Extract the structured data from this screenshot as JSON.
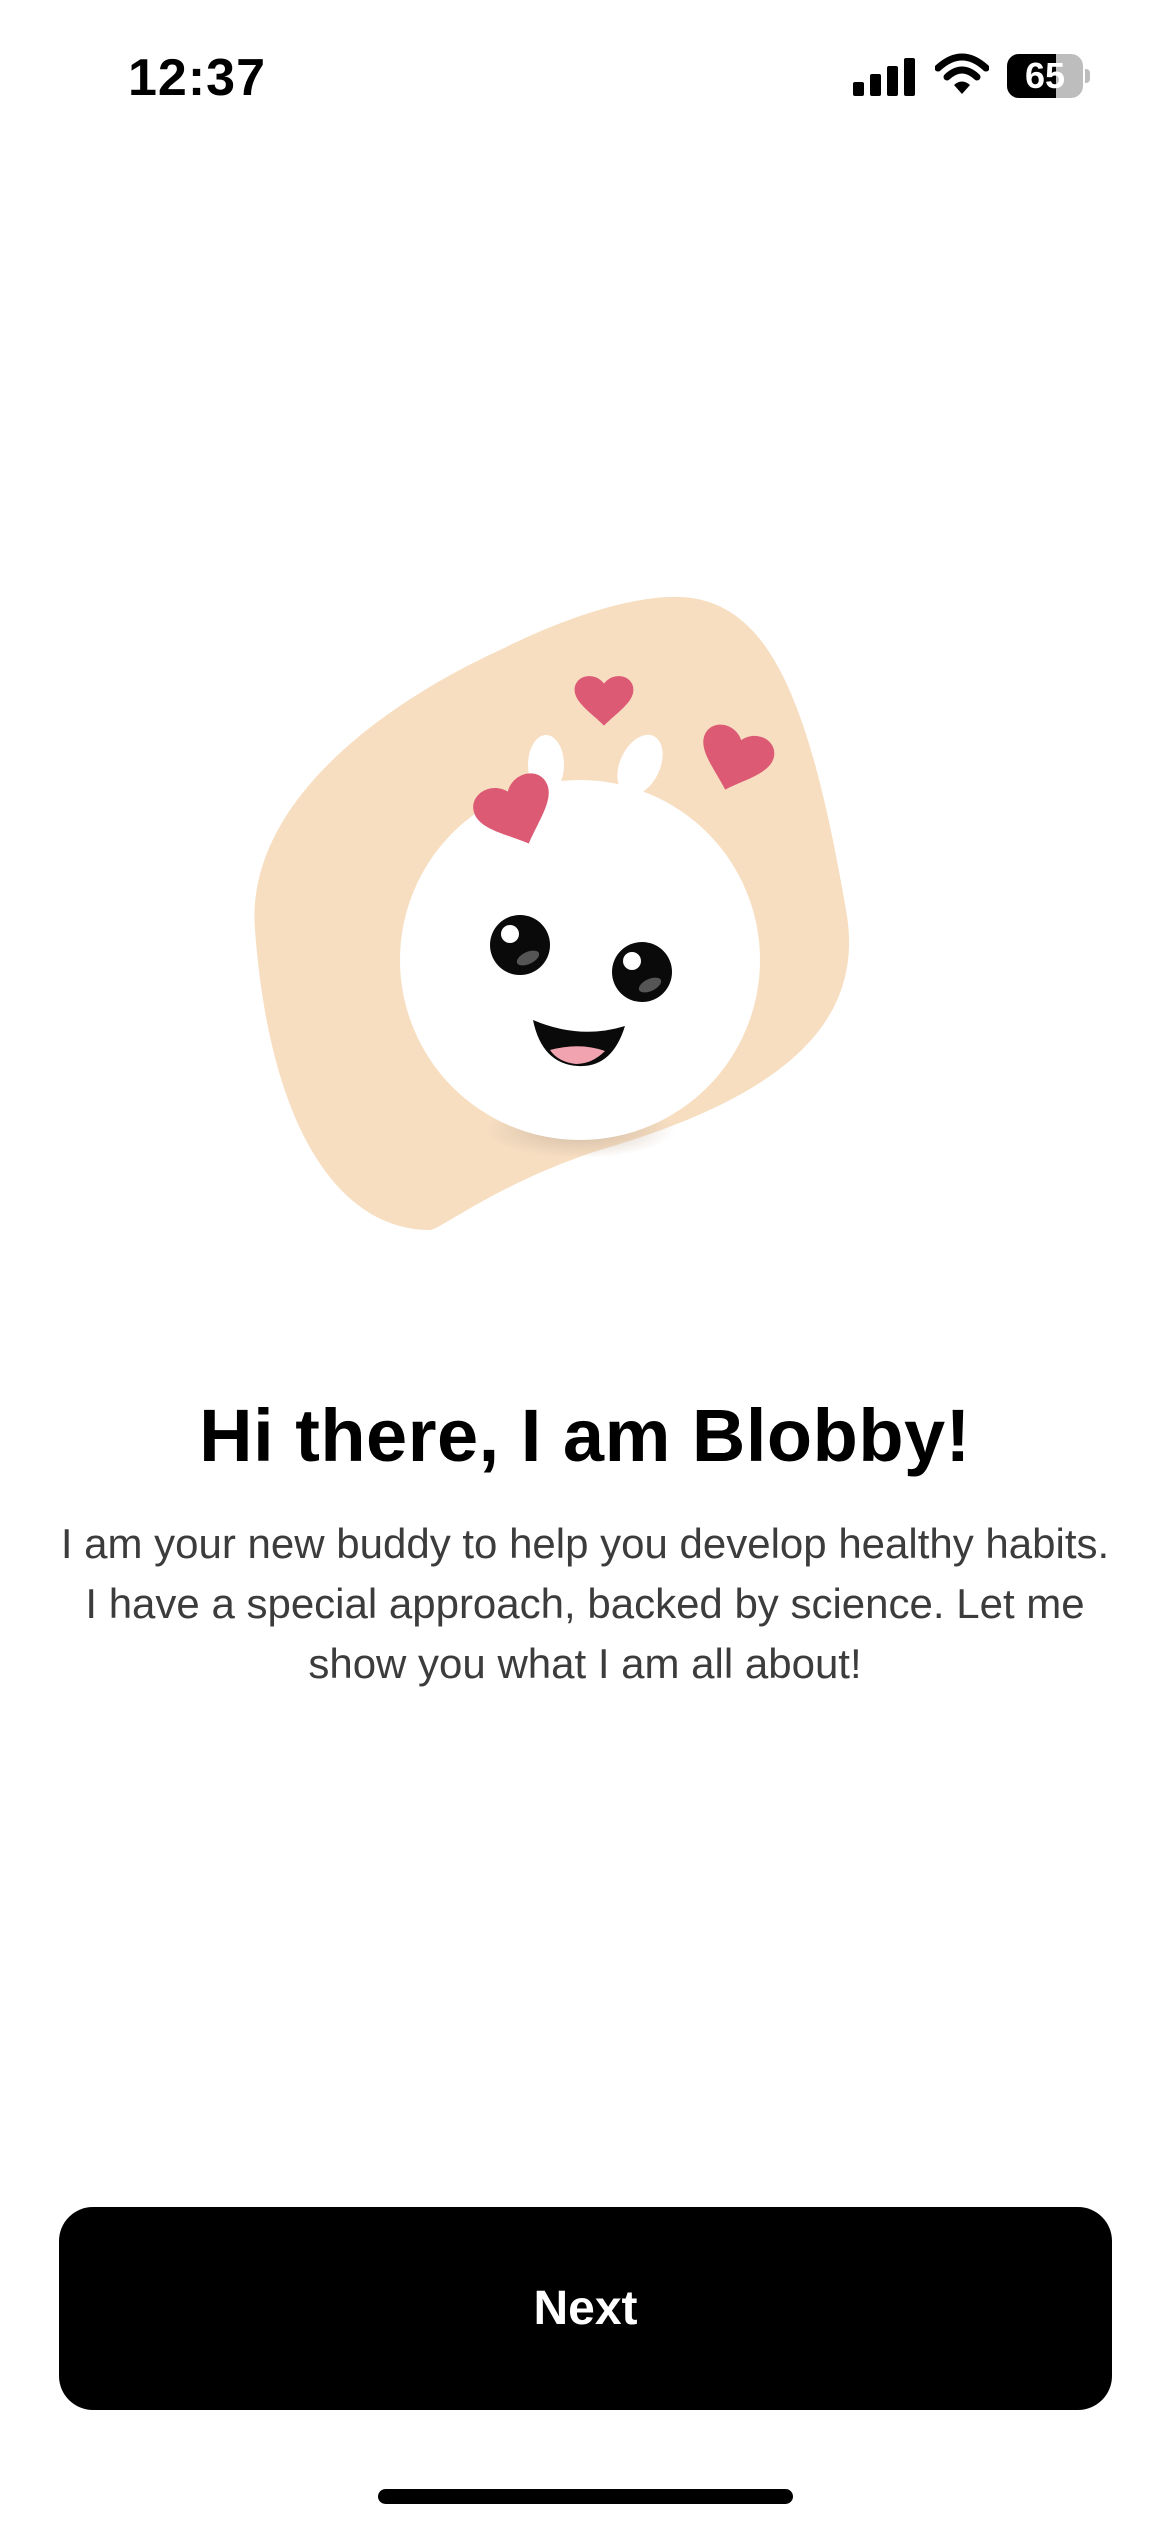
{
  "status_bar": {
    "time": "12:37",
    "battery_level": "65",
    "battery_fraction": 0.65
  },
  "onboarding": {
    "title": "Hi there, I am Blobby!",
    "description": "I am your new buddy to help you develop healthy habits. I have a special approach, backed by science. Let me show you what I am all about!",
    "next_label": "Next"
  },
  "colors": {
    "background": "#FFFFFF",
    "blob_background": "#F7DEC1",
    "heart": "#DC5A74",
    "button": "#000000",
    "button_text": "#FFFFFF",
    "body_text": "#3C3C3C",
    "mouth_tongue": "#F2A3B0"
  },
  "icons": {
    "signal": "cellular-signal-icon",
    "wifi": "wifi-icon",
    "battery": "battery-icon",
    "mascot": "blobby-mascot"
  }
}
